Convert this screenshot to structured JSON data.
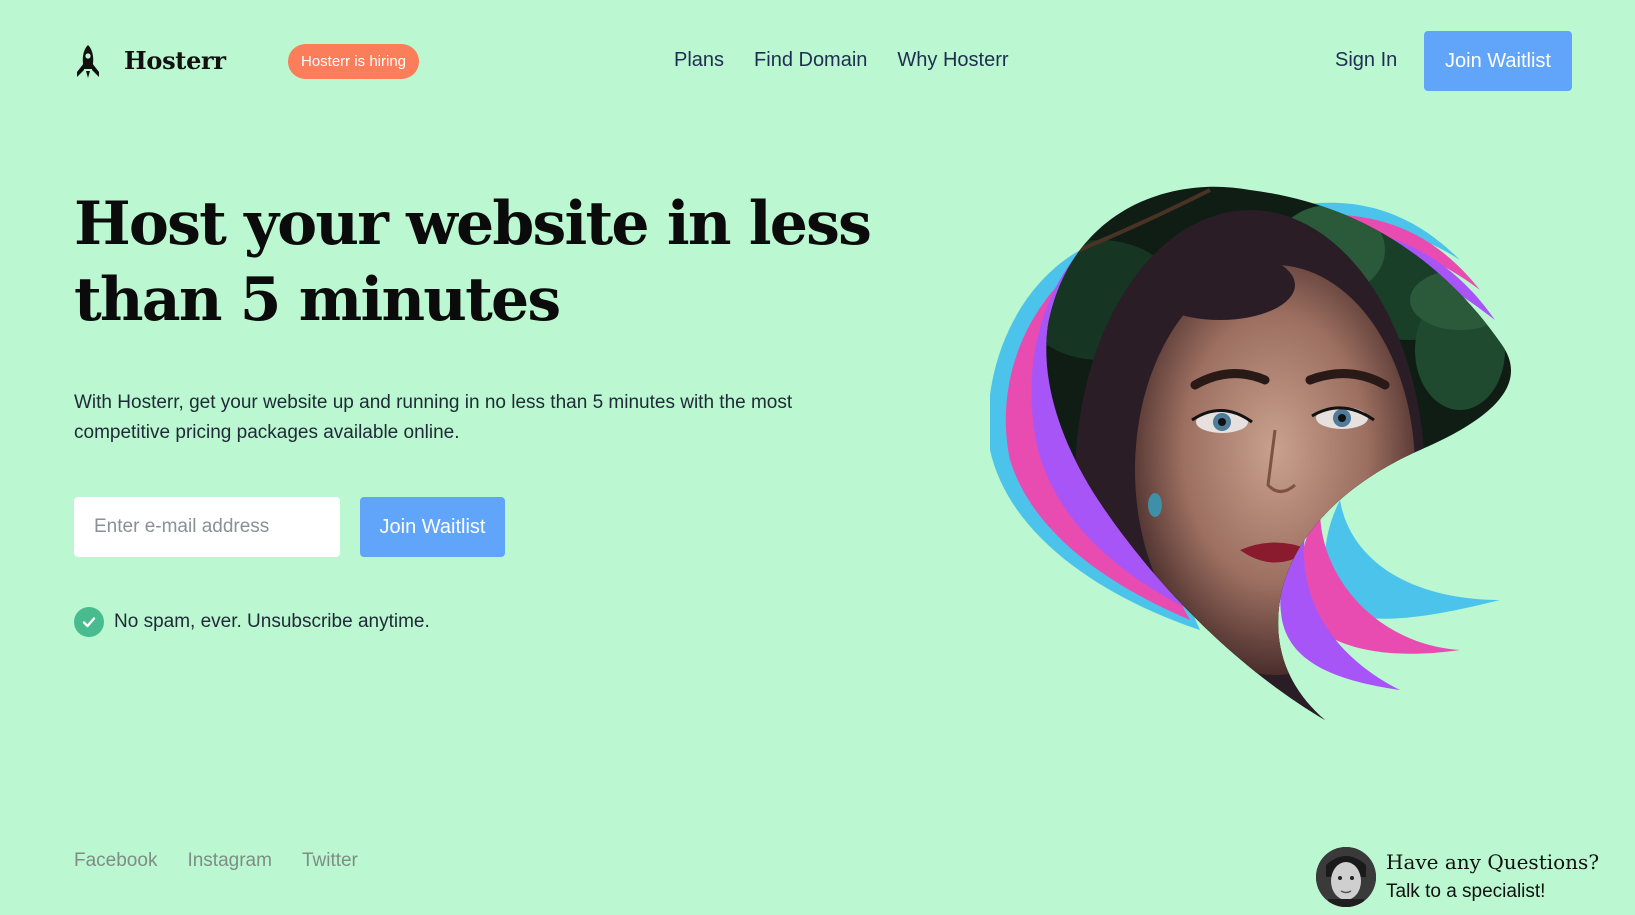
{
  "header": {
    "brand": "Hosterr",
    "hiring_badge": "Hosterr is hiring",
    "nav": [
      "Plans",
      "Find Domain",
      "Why Hosterr"
    ],
    "sign_in": "Sign In",
    "join_label": "Join Waitlist"
  },
  "hero": {
    "title": "Host your website in less than 5 minutes",
    "description": "With Hosterr, get your website up and running in no less than 5 minutes with the most competitive pricing packages available online.",
    "email_placeholder": "Enter e-mail address",
    "join_label": "Join Waitlist",
    "no_spam": "No spam, ever. Unsubscribe anytime."
  },
  "footer": {
    "social": [
      "Facebook",
      "Instagram",
      "Twitter"
    ],
    "contact_question": "Have any Questions?",
    "contact_cta": "Talk to a specialist!"
  },
  "colors": {
    "background": "#bbf7d0",
    "primary": "#60a5fa",
    "hiring": "#fb7d5a",
    "check": "#48bb8f",
    "ribbon_blue": "#4cc3ea",
    "ribbon_pink": "#e84cb0",
    "ribbon_purple": "#a855f7"
  }
}
